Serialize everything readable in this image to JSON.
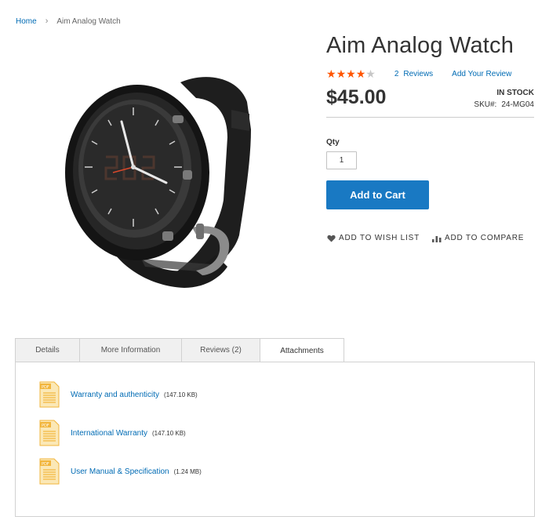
{
  "breadcrumb": {
    "home": "Home",
    "separator": "›",
    "current": "Aim Analog Watch"
  },
  "product": {
    "title": "Aim Analog Watch",
    "rating_stars": 4,
    "rating_max": 5,
    "reviews_count": "2",
    "reviews_label": "Reviews",
    "add_review_label": "Add Your Review",
    "price": "$45.00",
    "stock": "IN STOCK",
    "sku_label": "SKU#:",
    "sku": "24-MG04"
  },
  "cart": {
    "qty_label": "Qty",
    "qty_value": "1",
    "add_to_cart_label": "Add to Cart"
  },
  "actions": {
    "wishlist_label": "ADD TO WISH LIST",
    "compare_label": "ADD TO COMPARE"
  },
  "tabs": [
    {
      "label": "Details"
    },
    {
      "label": "More Information"
    },
    {
      "label": "Reviews (2)"
    },
    {
      "label": "Attachments",
      "active": true
    }
  ],
  "attachments": [
    {
      "name": "Warranty and authenticity",
      "size": "(147.10 KB)",
      "icon": "pdf-file-icon"
    },
    {
      "name": "International Warranty",
      "size": "(147.10 KB)",
      "icon": "pdf-file-icon"
    },
    {
      "name": "User Manual & Specification",
      "size": "(1.24 MB)",
      "icon": "pdf-file-icon"
    }
  ],
  "colors": {
    "accent": "#1979c3",
    "link": "#006bb4",
    "star": "#ff5501",
    "pdf": "#f2b53b"
  }
}
